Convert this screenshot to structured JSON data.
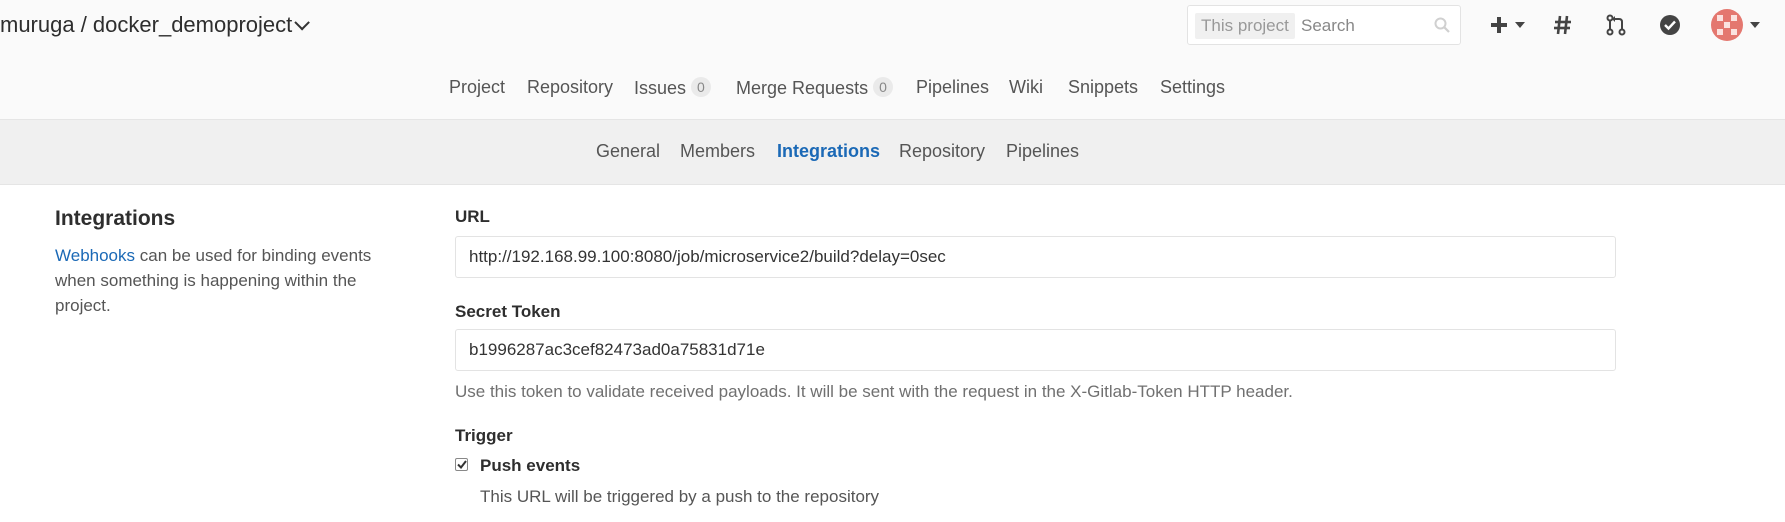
{
  "header": {
    "project_title": "muruga / docker_demoproject",
    "search_scope": "This project",
    "search_placeholder": "Search",
    "icons": [
      "plus-icon",
      "hash-icon",
      "merge-request-icon",
      "todo-check-icon",
      "avatar"
    ]
  },
  "nav": {
    "items": [
      {
        "label": "Project"
      },
      {
        "label": "Repository"
      },
      {
        "label": "Issues",
        "badge": "0"
      },
      {
        "label": "Merge Requests",
        "badge": "0"
      },
      {
        "label": "Pipelines"
      },
      {
        "label": "Wiki"
      },
      {
        "label": "Snippets"
      },
      {
        "label": "Settings"
      }
    ]
  },
  "subnav": {
    "items": [
      {
        "label": "General"
      },
      {
        "label": "Members"
      },
      {
        "label": "Integrations",
        "active": true
      },
      {
        "label": "Repository"
      },
      {
        "label": "Pipelines"
      }
    ]
  },
  "sidebar": {
    "title": "Integrations",
    "link": "Webhooks",
    "desc_rest": " can be used for binding events when something is happening within the project."
  },
  "form": {
    "url_label": "URL",
    "url_value": "http://192.168.99.100:8080/job/microservice2/build?delay=0sec",
    "token_label": "Secret Token",
    "token_value": "b1996287ac3cef82473ad0a75831d71e",
    "token_help": "Use this token to validate received payloads. It will be sent with the request in the X-Gitlab-Token HTTP header.",
    "trigger_label": "Trigger",
    "push_label": "Push events",
    "push_checked": true,
    "push_help": "This URL will be triggered by a push to the repository"
  },
  "colors": {
    "active_link": "#1b69b6",
    "avatar": "#e4776f"
  }
}
